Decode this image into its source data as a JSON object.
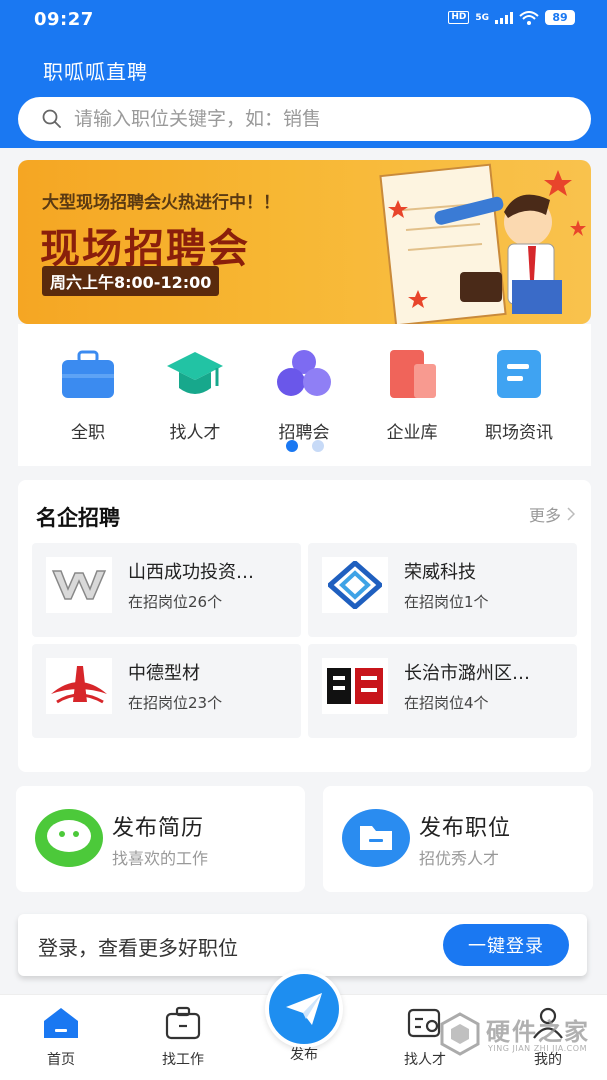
{
  "status": {
    "time": "09:27",
    "hd": "HD",
    "network": "5G",
    "battery": "89"
  },
  "app": {
    "title": "职呱呱直聘"
  },
  "search": {
    "placeholder": "请输入职位关键字，如：销售"
  },
  "banner": {
    "subtitle": "大型现场招聘会火热进行中！！",
    "title": "现场招聘会",
    "time": "周六上午8:00-12:00",
    "sign": "招聘会"
  },
  "categories": [
    {
      "label": "全职",
      "icon": "briefcase-icon"
    },
    {
      "label": "找人才",
      "icon": "graduation-cap-icon"
    },
    {
      "label": "招聘会",
      "icon": "group-icon"
    },
    {
      "label": "企业库",
      "icon": "building-icon"
    },
    {
      "label": "职场资讯",
      "icon": "news-icon"
    }
  ],
  "enterprises": {
    "title": "名企招聘",
    "more": "更多",
    "items": [
      {
        "name": "山西成功投资…",
        "count": "在招岗位26个",
        "logo": "wuling-logo"
      },
      {
        "name": "荣威科技",
        "count": "在招岗位1个",
        "logo": "diamond-logo"
      },
      {
        "name": "中德型材",
        "count": "在招岗位23个",
        "logo": "red-swoosh-logo"
      },
      {
        "name": "长治市潞州区…",
        "count": "在招岗位4个",
        "logo": "zhaopin-logo"
      }
    ]
  },
  "actions": [
    {
      "title": "发布简历",
      "subtitle": "找喜欢的工作",
      "color": "#4cc93a"
    },
    {
      "title": "发布职位",
      "subtitle": "招优秀人才",
      "color": "#2a8cf0"
    }
  ],
  "login": {
    "text": "登录，查看更多好职位",
    "button": "一键登录"
  },
  "tabs": [
    {
      "label": "首页"
    },
    {
      "label": "找工作"
    },
    {
      "label": "发布"
    },
    {
      "label": "找人才"
    },
    {
      "label": "我的"
    }
  ],
  "watermark": {
    "text": "硬件之家",
    "sub": "YING JIAN ZHI JIA.COM"
  },
  "colors": {
    "primary": "#1a78f2",
    "banner": "#f5a623",
    "background": "#f4f5f7"
  }
}
